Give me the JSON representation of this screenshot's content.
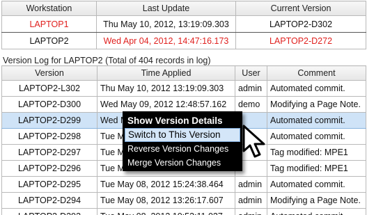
{
  "workstations": {
    "headers": [
      "Workstation",
      "Last Update",
      "Current Version"
    ],
    "rows": [
      {
        "name": "LAPTOP1",
        "last_update": "Thu May 10, 2012, 13:19:09.303",
        "current_version": "LAPTOP2-D302"
      },
      {
        "name": "LAPTOP2",
        "last_update": "Wed Apr 04, 2012, 14:47:16.173",
        "current_version": "LAPTOP2-D272"
      }
    ]
  },
  "version_log": {
    "caption": "Version Log for LAPTOP2 (Total of 404 records in log)",
    "headers": [
      "Version",
      "Time Applied",
      "User",
      "Comment"
    ],
    "rows": [
      {
        "version": "LAPTOP2-L302",
        "time": "Thu May 10, 2012 13:19:09.303",
        "user": "admin",
        "comment": "Automated commit."
      },
      {
        "version": "LAPTOP2-D300",
        "time": "Wed May 09, 2012 12:48:57.162",
        "user": "demo",
        "comment": "Modifying a Page Note."
      },
      {
        "version": "LAPTOP2-D299",
        "time": "Wed M",
        "user": "",
        "comment": "Automated commit."
      },
      {
        "version": "LAPTOP2-D298",
        "time": "Tue M",
        "user": "",
        "comment": "Automated commit."
      },
      {
        "version": "LAPTOP2-D297",
        "time": "Tue M",
        "user": "",
        "comment": "Tag modified: MPE1"
      },
      {
        "version": "LAPTOP2-D296",
        "time": "Tue M",
        "user": "",
        "comment": "Tag modified: MPE1"
      },
      {
        "version": "LAPTOP2-D295",
        "time": "Tue May 08, 2012 15:24:38.464",
        "user": "admin",
        "comment": "Automated commit."
      },
      {
        "version": "LAPTOP2-D294",
        "time": "Tue May 08, 2012 13:26:17.607",
        "user": "admin",
        "comment": "Modifying a Page Note."
      },
      {
        "version": "LAPTOP2-D293",
        "time": "Tue May 08, 2012 10:53:11.027",
        "user": "admin",
        "comment": "Automated commit."
      }
    ]
  },
  "context_menu": {
    "items": [
      "Show Version Details",
      "Switch to This Version",
      "Reverse Version Changes",
      "Merge Version Changes"
    ]
  },
  "colors": {
    "highlight_red": "#e0201e",
    "selected_row": "#cfe3f7",
    "menu_background": "#000000",
    "menu_hover": "#d4e6f8"
  },
  "icons": {
    "pointer": "arrow-cursor-icon"
  }
}
